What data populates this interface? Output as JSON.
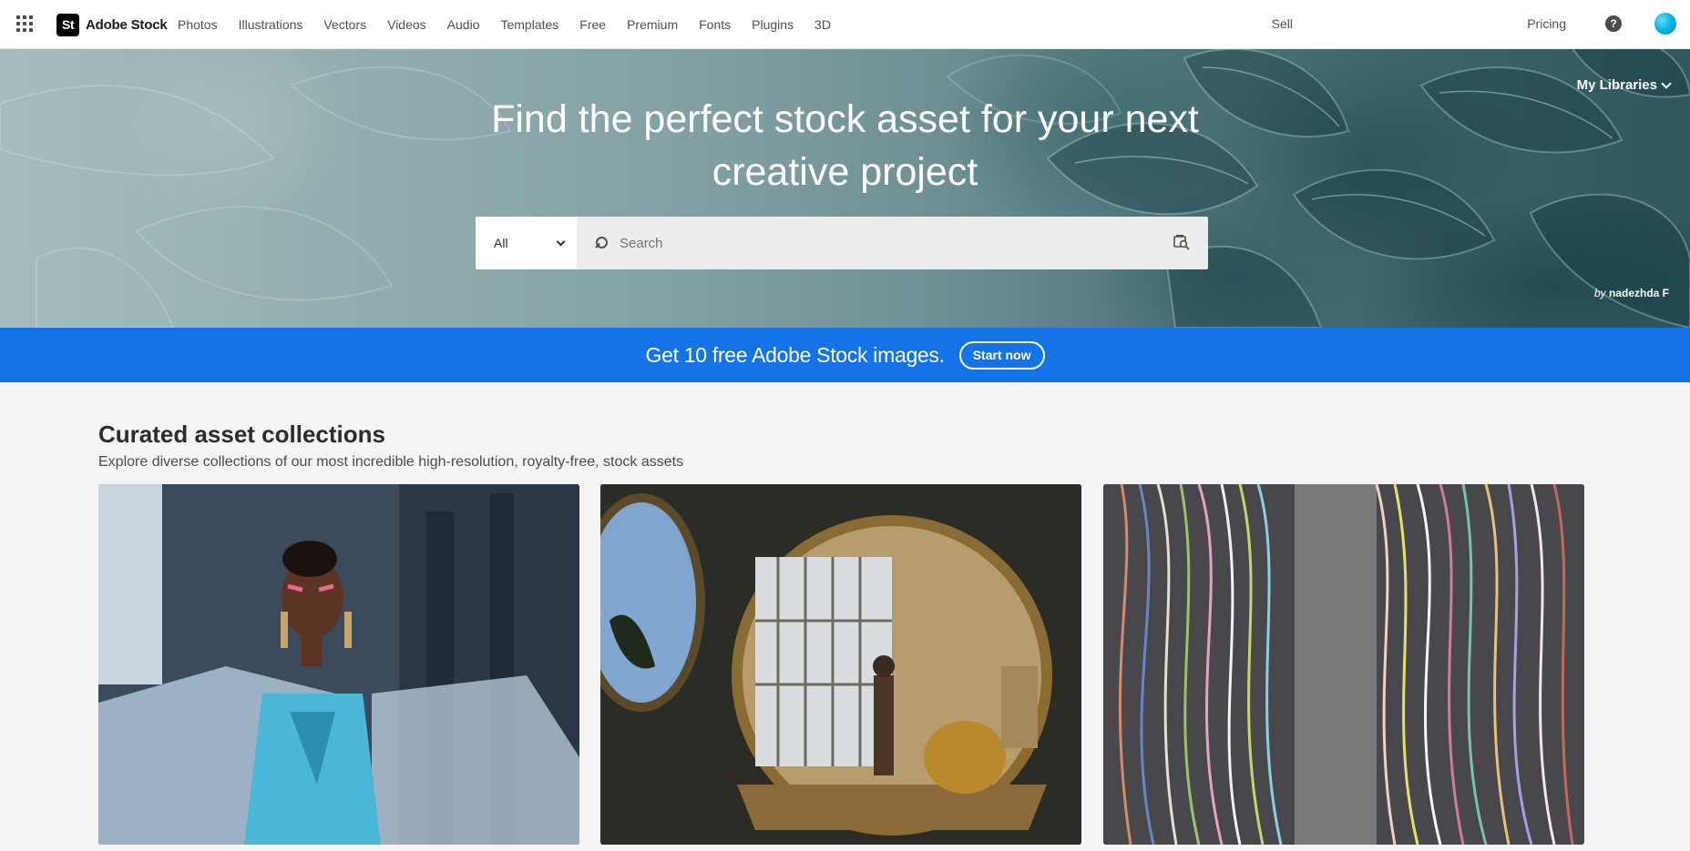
{
  "nav": {
    "brand_mark": "St",
    "brand_name": "Adobe Stock",
    "links": [
      "Photos",
      "Illustrations",
      "Vectors",
      "Videos",
      "Audio",
      "Templates",
      "Free",
      "Premium",
      "Fonts",
      "Plugins",
      "3D"
    ],
    "sell": "Sell",
    "pricing": "Pricing",
    "help_glyph": "?"
  },
  "hero": {
    "my_libraries": "My Libraries",
    "title_line1": "Find the perfect stock asset for your next",
    "title_line2": "creative project",
    "filter_value": "All",
    "search_placeholder": "Search",
    "credit_by": "by",
    "credit_name": "nadezhda F"
  },
  "promo": {
    "text": "Get 10 free Adobe Stock images.",
    "button": "Start now",
    "color": "#1473e6"
  },
  "collections": {
    "title": "Curated asset collections",
    "subtitle": "Explore diverse collections of our most incredible high-resolution, royalty-free, stock assets"
  },
  "icons": {
    "apps": "apps-grid-icon",
    "help": "help-icon",
    "search": "search-icon",
    "visual_search": "visual-search-icon",
    "chevron": "chevron-down-icon"
  }
}
